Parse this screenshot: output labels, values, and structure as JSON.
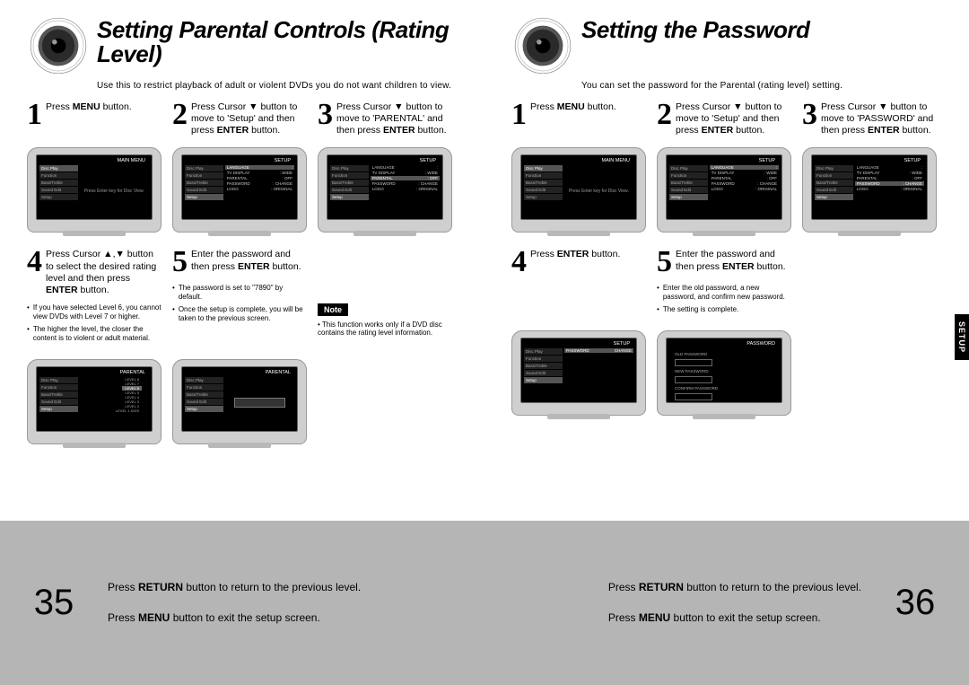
{
  "left": {
    "title": "Setting Parental Controls (Rating Level)",
    "sub": "Use this to restrict playback of adult or violent DVDs you do not want children to view.",
    "steps": {
      "s1": "Press <b>MENU</b> button.",
      "s2": "Press Cursor ▼ button to move to 'Setup' and then press <b>ENTER</b> button.",
      "s3": "Press Cursor ▼ button to move to 'PARENTAL' and then press <b>ENTER</b> button.",
      "s4": "Press Cursor ▲,▼ button to select the desired rating level and then press <b>ENTER</b> button.",
      "s5": "Enter the password and then press <b>ENTER</b> button."
    },
    "bullets4": [
      "If you have selected Level 6, you cannot view DVDs with Level 7 or higher.",
      "The higher the level, the closer the content is to violent or adult material."
    ],
    "bullets5": [
      "The password is set to \"7890\" by default.",
      "Once the setup is complete, you will be taken to the previous screen."
    ],
    "noteLabel": "Note",
    "note": "This function works only if a DVD disc contains the rating level information."
  },
  "right": {
    "title": "Setting the Password",
    "sub": "You can set the password for the Parental (rating level) setting.",
    "steps": {
      "s1": "Press <b>MENU</b> button.",
      "s2": "Press Cursor ▼ button to move to 'Setup' and then press <b>ENTER</b> button.",
      "s3": "Press Cursor ▼ button to move to 'PASSWORD' and then press <b>ENTER</b> button.",
      "s4": "Press <b>ENTER</b> button.",
      "s5": "Enter the password and then press <b>ENTER</b> button."
    },
    "bullets5": [
      "Enter the old password, a new password, and confirm new password.",
      "The setting is complete."
    ],
    "sideTab": "SETUP"
  },
  "osd": {
    "main_menu_title": "MAIN MENU",
    "setup_title": "SETUP",
    "parental_title": "PARENTAL",
    "password_title": "PASSWORD",
    "left_items": [
      "Disc Play",
      "Function",
      "Bass/Treble",
      "Sound Edit",
      "Setup"
    ],
    "setup_items": [
      {
        "k": "LANGUAGE",
        "v": ""
      },
      {
        "k": "TV DISPLAY",
        "v": "WIDE"
      },
      {
        "k": "PARENTAL",
        "v": "OFF"
      },
      {
        "k": "PASSWORD",
        "v": "CHANGE"
      },
      {
        "k": "LOGO",
        "v": "ORIGINAL"
      }
    ],
    "msg": "Press Enter key for Disc View.",
    "levels": [
      "LEVEL 8",
      "LEVEL 7",
      "LEVEL 6",
      "LEVEL 5",
      "LEVEL 4",
      "LEVEL 3",
      "LEVEL 2",
      "LEVEL 1 KIDS"
    ],
    "pwd_change": {
      "k": "PASSWORD",
      "v": "CHANGE"
    },
    "pwd_labels": [
      "OLD PASSWORD",
      "NEW PASSWORD",
      "CONFIRM PASSWORD"
    ]
  },
  "footer": {
    "pgLeft": "35",
    "pgRight": "36",
    "line1": "Press <b>RETURN</b> button to return to the previous level.",
    "line2": "Press <b>MENU</b> button to exit the setup screen."
  }
}
